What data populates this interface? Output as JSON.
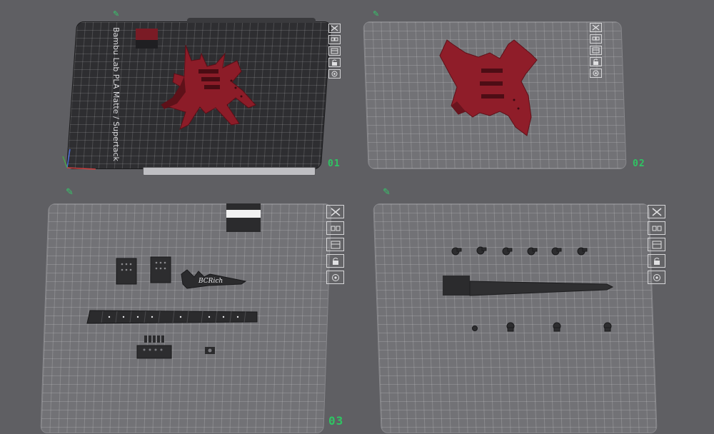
{
  "plates": [
    {
      "id": "plate-01",
      "number": "01",
      "theme": "dark"
    },
    {
      "id": "plate-02",
      "number": "02",
      "theme": "light"
    },
    {
      "id": "plate-03",
      "number": "03",
      "theme": "light"
    },
    {
      "id": "plate-04",
      "number": "",
      "theme": "light"
    }
  ],
  "plate_01": {
    "number": "01",
    "vertical_label": "Bambu Lab PLA Matte / Supertack"
  },
  "plate_02": {
    "number": "02"
  },
  "plate_03": {
    "number": "03",
    "headstock_logo": "BCRich"
  },
  "plate_tag_icon": "edit-pencil-icon",
  "plate_tools": [
    {
      "name": "delete-plate-button",
      "icon": "close-icon"
    },
    {
      "name": "auto-arrange-button",
      "icon": "arrange-icon"
    },
    {
      "name": "plate-settings-button",
      "icon": "settings-icon"
    },
    {
      "name": "lock-plate-button",
      "icon": "lock-icon"
    },
    {
      "name": "orient-button",
      "icon": "orient-icon"
    }
  ],
  "colors": {
    "background": "#5f5f63",
    "dark_plate": "#2e2e31",
    "light_plate": "#727276",
    "accent_green": "#2fc463",
    "body_red": "#8c1c28",
    "part_black": "#2b2b2d"
  }
}
